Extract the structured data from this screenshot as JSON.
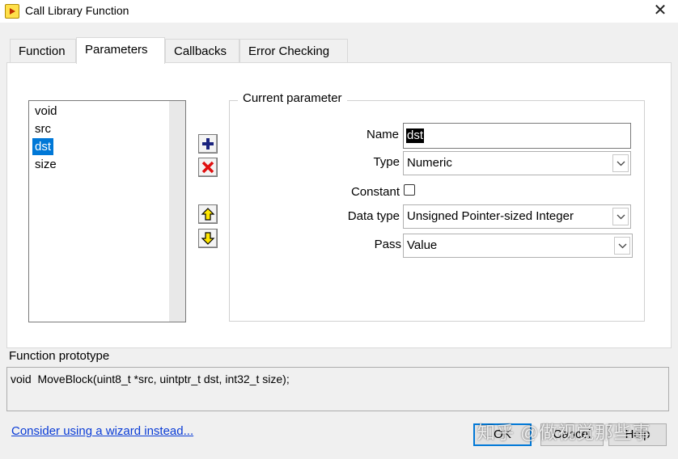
{
  "window": {
    "title": "Call Library Function",
    "app_icon": "labview-node-icon",
    "close_icon": "close-icon"
  },
  "tabs": [
    {
      "label": "Function",
      "active": false
    },
    {
      "label": "Parameters",
      "active": true
    },
    {
      "label": "Callbacks",
      "active": false
    },
    {
      "label": "Error Checking",
      "active": false
    }
  ],
  "parameters": {
    "list": [
      "void",
      "src",
      "dst",
      "size"
    ],
    "selected": "dst",
    "tool_buttons": {
      "add_icon": "plus-icon",
      "delete_icon": "delete-x-icon",
      "move_up_icon": "arrow-up-icon",
      "move_down_icon": "arrow-down-icon"
    }
  },
  "current_parameter": {
    "group_title": "Current parameter",
    "name_label": "Name",
    "name_value": "dst",
    "type_label": "Type",
    "type_value": "Numeric",
    "constant_label": "Constant",
    "constant_checked": false,
    "data_type_label": "Data type",
    "data_type_value": "Unsigned Pointer-sized Integer",
    "pass_label": "Pass",
    "pass_value": "Value"
  },
  "prototype": {
    "label": "Function prototype",
    "text": "void  MoveBlock(uint8_t *src, uintptr_t dst, int32_t size);"
  },
  "footer": {
    "wizard_link": "Consider using a wizard instead...",
    "ok_label": "OK",
    "cancel_label": "Cancel",
    "help_label": "Help",
    "watermark": "知乎 @做视觉那些事"
  }
}
